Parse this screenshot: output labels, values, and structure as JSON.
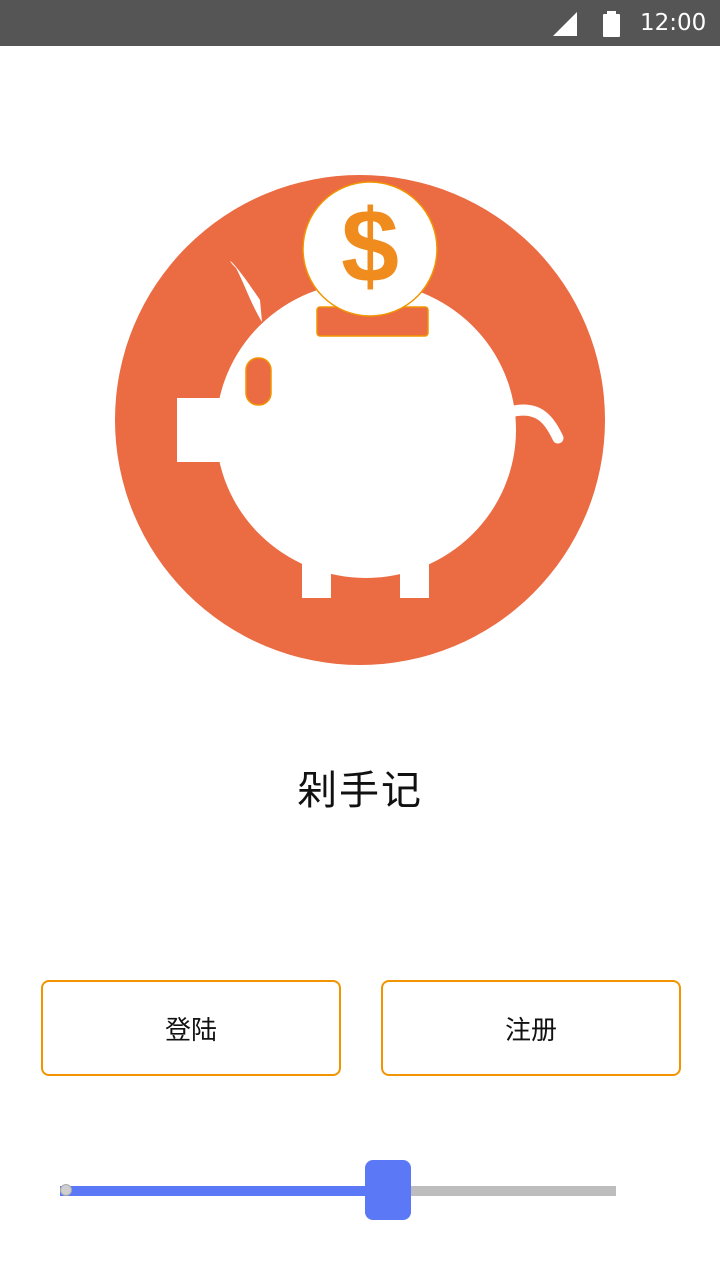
{
  "status_bar": {
    "time": "12:00",
    "icons": [
      "signal-icon",
      "battery-icon"
    ]
  },
  "logo": {
    "icon": "piggy-bank-icon",
    "coin_symbol": "$",
    "colors": {
      "circle": "#EB6B42",
      "coin": "#F08C1E",
      "pig": "#FFFFFF"
    }
  },
  "app": {
    "title": "剁手记"
  },
  "buttons": {
    "login_label": "登陆",
    "register_label": "注册",
    "border_color": "#F29400"
  },
  "slider": {
    "value": 0.59,
    "active_color": "#5B79F6",
    "inactive_color": "#BDBDBD"
  }
}
